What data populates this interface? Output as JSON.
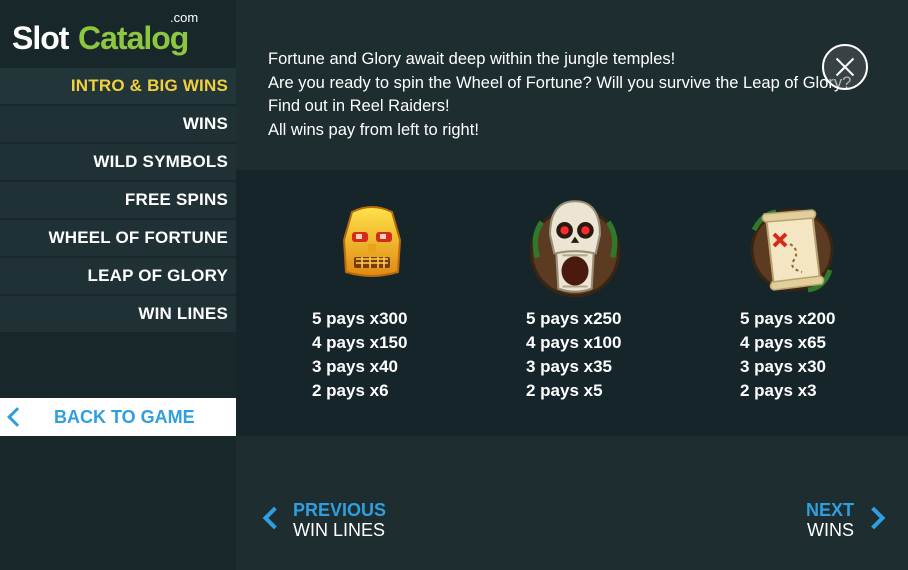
{
  "logo": {
    "slot": "Slot",
    "catalog": "Catalog",
    "com": ".com"
  },
  "menu": [
    {
      "label": "INTRO & BIG WINS",
      "active": true
    },
    {
      "label": "WINS"
    },
    {
      "label": "WILD SYMBOLS"
    },
    {
      "label": "FREE SPINS"
    },
    {
      "label": "WHEEL OF FORTUNE"
    },
    {
      "label": "LEAP OF GLORY"
    },
    {
      "label": "WIN LINES"
    }
  ],
  "back_button": {
    "label": "BACK TO GAME"
  },
  "intro": {
    "lines": [
      "Fortune and Glory await deep within the jungle temples!",
      "Are you ready to spin the Wheel of Fortune? Will you survive the Leap of Glory?",
      "Find out in Reel Raiders!",
      "All wins pay from left to right!"
    ]
  },
  "symbols": [
    {
      "icon": "golden-mask-icon",
      "pays": [
        "5 pays x300",
        "4 pays x150",
        "3 pays x40",
        "2 pays x6"
      ]
    },
    {
      "icon": "skull-icon",
      "pays": [
        "5 pays x250",
        "4 pays x100",
        "3 pays x35",
        "2 pays x5"
      ]
    },
    {
      "icon": "treasure-map-icon",
      "pays": [
        "5 pays x200",
        "4 pays x65",
        "3 pays x30",
        "2 pays x3"
      ]
    }
  ],
  "nav": {
    "previous": {
      "label": "PREVIOUS",
      "target": "WIN LINES"
    },
    "next": {
      "label": "NEXT",
      "target": "WINS"
    }
  },
  "colors": {
    "accent": "#2f9fe0",
    "active_menu": "#f2cf3c",
    "logo_green": "#8dc63f"
  }
}
